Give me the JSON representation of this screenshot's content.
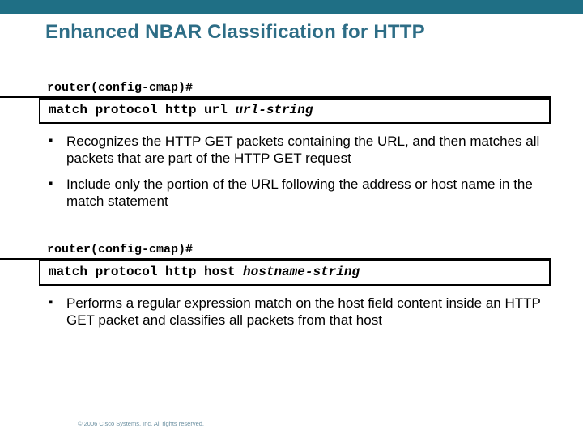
{
  "title": "Enhanced NBAR Classification for HTTP",
  "block1": {
    "prompt": "router(config-cmap)#",
    "code_static": "match protocol http url ",
    "code_var": "url-string",
    "bullets": [
      "Recognizes the HTTP GET packets containing the URL, and then matches all packets that are part of the HTTP GET request",
      "Include only the portion of the URL following the address or host name in the match statement"
    ]
  },
  "block2": {
    "prompt": "router(config-cmap)#",
    "code_static": "match protocol http host ",
    "code_var": "hostname-string",
    "bullets": [
      "Performs a regular expression match on the host field content inside an HTTP GET packet and classifies all packets from that host"
    ]
  },
  "footer": "© 2006 Cisco Systems, Inc. All rights reserved."
}
